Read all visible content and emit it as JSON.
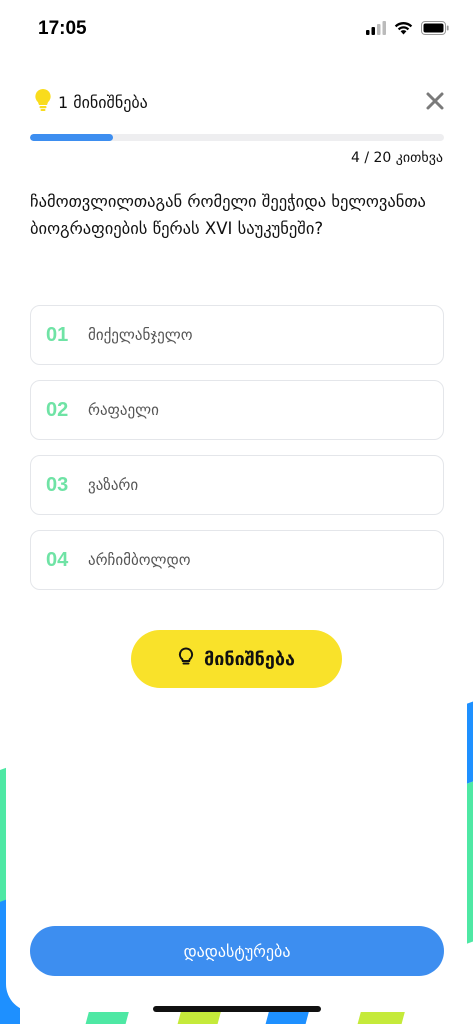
{
  "status_bar": {
    "time": "17:05",
    "icons": [
      "signal-icon",
      "wifi-icon",
      "battery-icon"
    ]
  },
  "header": {
    "hints_label": "1 მინიშნება",
    "hint_icon": "lightbulb-icon",
    "close_icon": "close-icon"
  },
  "progress": {
    "current": 4,
    "total": 20,
    "fraction": 0.2,
    "label": "4 / 20 კითხვა"
  },
  "question": {
    "text": "ჩამოთვლილთაგან რომელი შეეჭიდა ხელოვანთა ბიოგრაფიების წერას XVI საუკუნეში?"
  },
  "options": [
    {
      "number": "01",
      "text": "მიქელანჯელო"
    },
    {
      "number": "02",
      "text": "რაფაელი"
    },
    {
      "number": "03",
      "text": "ვაზარი"
    },
    {
      "number": "04",
      "text": "არჩიმბოლდო"
    }
  ],
  "hint_button": {
    "label": "მინიშნება",
    "icon": "lightbulb-outline-icon"
  },
  "confirm_button": {
    "label": "დადასტურება"
  },
  "colors": {
    "accent_blue": "#3d8ef0",
    "hint_yellow": "#f9e22a",
    "option_number_green": "#6fe3a5",
    "stripe_green": "#4ee8a4",
    "stripe_blue": "#1e90ff",
    "stripe_lime": "#c5ea3a"
  }
}
